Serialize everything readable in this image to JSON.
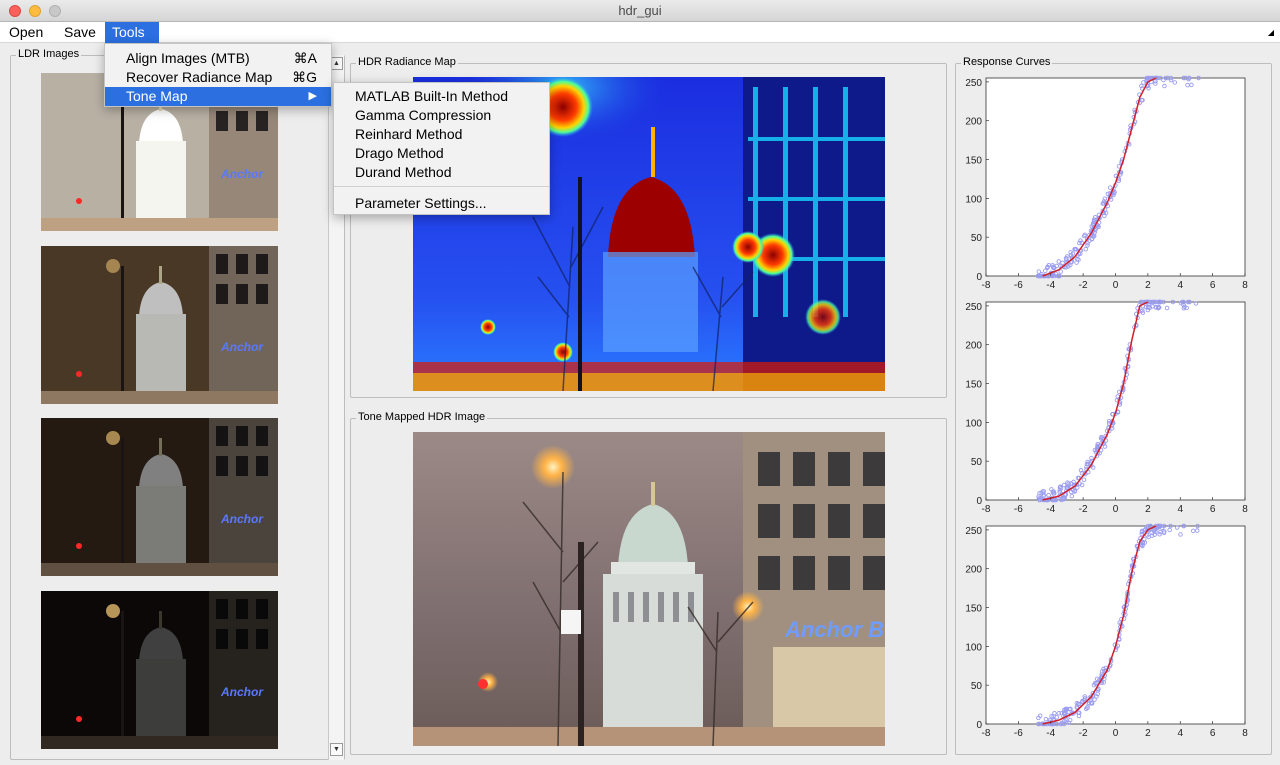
{
  "window": {
    "title": "hdr_gui"
  },
  "menubar": {
    "open": "Open",
    "save": "Save",
    "tools": "Tools"
  },
  "tools_menu": {
    "items": [
      {
        "label": "Align Images (MTB)",
        "shortcut": "⌘A"
      },
      {
        "label": "Recover Radiance Map",
        "shortcut": "⌘G"
      },
      {
        "label": "Tone Map",
        "submenu_arrow": "▶"
      }
    ]
  },
  "tonemap_submenu": {
    "items": [
      "MATLAB Built-In Method",
      "Gamma Compression",
      "Reinhard Method",
      "Drago Method",
      "Durand Method"
    ],
    "settings": "Parameter Settings..."
  },
  "panels": {
    "ldr": "LDR Images",
    "radiance": "HDR Radiance Map",
    "tonemapped": "Tone Mapped HDR Image",
    "curves": "Response Curves"
  },
  "ldr_images": [
    {
      "exposure": "brightest",
      "bg": "#b8b0a3"
    },
    {
      "exposure": "bright",
      "bg": "#4a3826"
    },
    {
      "exposure": "dark",
      "bg": "#241a12"
    },
    {
      "exposure": "darkest",
      "bg": "#0b0807"
    }
  ],
  "colors": {
    "accent": "#2b6fe0",
    "curve": "#d0202a",
    "points": "#9a9cf0",
    "close": "#fc605b",
    "minimize": "#fdbc40",
    "zoom": "#c8c8c8"
  },
  "chart_data": [
    {
      "type": "scatter",
      "xlim": [
        -8,
        8
      ],
      "ylim": [
        0,
        250
      ],
      "xticks": [
        "-8",
        "-6",
        "-4",
        "-2",
        "0",
        "2",
        "4",
        "6",
        "8"
      ],
      "yticks": [
        "0",
        "50",
        "100",
        "150",
        "200",
        "250"
      ],
      "curve": {
        "x": [
          -4.5,
          -3.5,
          -2.5,
          -1.5,
          -0.5,
          0,
          0.5,
          1,
          1.5,
          2,
          2.5
        ],
        "y": [
          0,
          8,
          25,
          55,
          95,
          120,
          150,
          190,
          230,
          250,
          255
        ]
      }
    },
    {
      "type": "scatter",
      "xlim": [
        -8,
        8
      ],
      "ylim": [
        0,
        250
      ],
      "xticks": [
        "-8",
        "-6",
        "-4",
        "-2",
        "0",
        "2",
        "4",
        "6",
        "8"
      ],
      "yticks": [
        "0",
        "50",
        "100",
        "150",
        "200",
        "250"
      ],
      "curve": {
        "x": [
          -4.5,
          -3.5,
          -2.5,
          -1.5,
          -0.5,
          0,
          0.5,
          1,
          1.5,
          2
        ],
        "y": [
          0,
          5,
          18,
          45,
          85,
          112,
          150,
          205,
          250,
          255
        ]
      }
    },
    {
      "type": "scatter",
      "xlim": [
        -8,
        8
      ],
      "ylim": [
        0,
        250
      ],
      "xticks": [
        "-8",
        "-6",
        "-4",
        "-2",
        "0",
        "2",
        "4",
        "6",
        "8"
      ],
      "yticks": [
        "0",
        "50",
        "100",
        "150",
        "200",
        "250"
      ],
      "curve": {
        "x": [
          -4.5,
          -3.5,
          -2.5,
          -1.5,
          -0.5,
          0,
          0.5,
          1,
          1.5,
          2,
          2.5
        ],
        "y": [
          0,
          5,
          15,
          35,
          70,
          100,
          140,
          195,
          235,
          250,
          255
        ]
      }
    }
  ]
}
